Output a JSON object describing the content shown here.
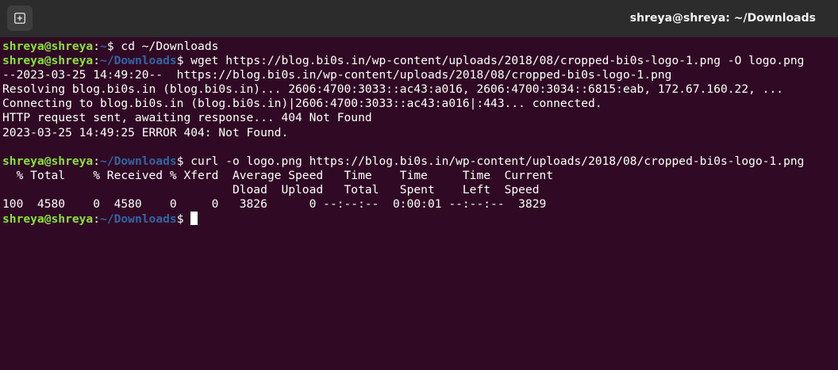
{
  "window": {
    "title": "shreya@shreya: ~/Downloads",
    "new_tab_icon": "new-tab-icon"
  },
  "terminal": {
    "prompt_user": "shreya@shreya",
    "colon": ":",
    "lines": [
      {
        "type": "prompt",
        "path": "~",
        "dollar": "$ ",
        "cmd": "cd ~/Downloads"
      },
      {
        "type": "prompt",
        "path": "~/Downloads",
        "dollar": "$ ",
        "cmd": "wget https://blog.bi0s.in/wp-content/uploads/2018/08/cropped-bi0s-logo-1.png -O logo.png"
      },
      {
        "type": "output",
        "text": "--2023-03-25 14:49:20--  https://blog.bi0s.in/wp-content/uploads/2018/08/cropped-bi0s-logo-1.png"
      },
      {
        "type": "output",
        "text": "Resolving blog.bi0s.in (blog.bi0s.in)... 2606:4700:3033::ac43:a016, 2606:4700:3034::6815:eab, 172.67.160.22, ..."
      },
      {
        "type": "output",
        "text": "Connecting to blog.bi0s.in (blog.bi0s.in)|2606:4700:3033::ac43:a016|:443... connected."
      },
      {
        "type": "output",
        "text": "HTTP request sent, awaiting response... 404 Not Found"
      },
      {
        "type": "output",
        "text": "2023-03-25 14:49:25 ERROR 404: Not Found."
      },
      {
        "type": "output",
        "text": ""
      },
      {
        "type": "prompt",
        "path": "~/Downloads",
        "dollar": "$ ",
        "cmd": "curl -o logo.png https://blog.bi0s.in/wp-content/uploads/2018/08/cropped-bi0s-logo-1.png"
      },
      {
        "type": "output",
        "text": "  % Total    % Received % Xferd  Average Speed   Time    Time     Time  Current"
      },
      {
        "type": "output",
        "text": "                                 Dload  Upload   Total   Spent    Left  Speed"
      },
      {
        "type": "output",
        "text": "100  4580    0  4580    0     0   3826      0 --:--:--  0:00:01 --:--:--  3829"
      },
      {
        "type": "prompt_active",
        "path": "~/Downloads",
        "dollar": "$ ",
        "cmd": ""
      }
    ]
  },
  "colors": {
    "background": "#300a24",
    "titlebar": "#2c2c2c",
    "user": "#8ae234",
    "path": "#3465a4",
    "text": "#ffffff"
  }
}
